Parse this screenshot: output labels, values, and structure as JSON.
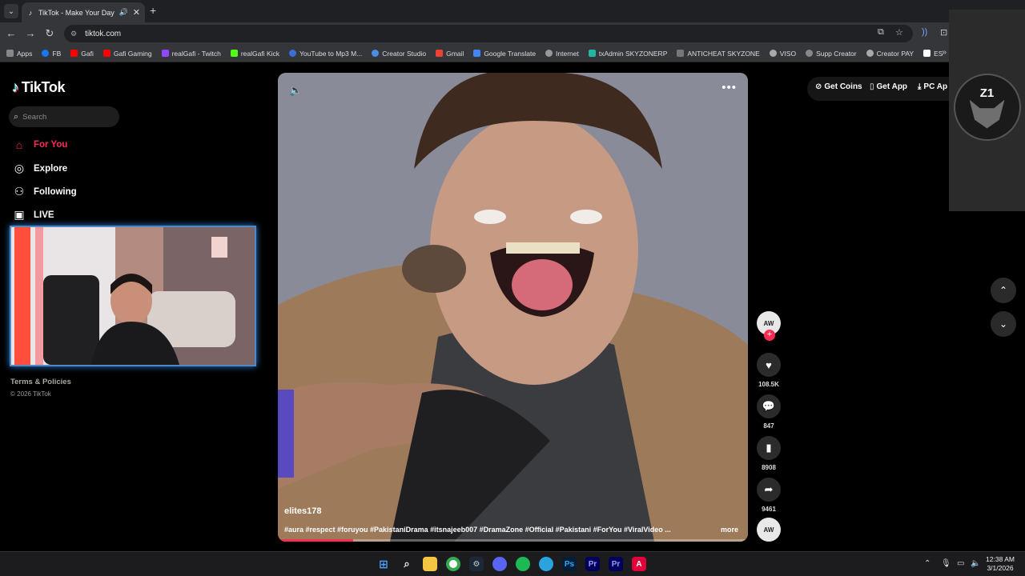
{
  "browser": {
    "tab_title": "TikTok - Make Your Day",
    "url": "tiktok.com",
    "bookmarks": [
      "Apps",
      "FB",
      "Gafi",
      "Gafi Gaming",
      "realGafi - Twitch",
      "realGafi Kick",
      "YouTube to Mp3 M...",
      "Creator Studio",
      "Gmail",
      "Google Translate",
      "Internet",
      "txAdmin SKYZONERP",
      "ANTICHEAT SKYZONE",
      "VISO",
      "Supp Creator",
      "Creator PAY",
      "ES"
    ]
  },
  "sidebar": {
    "logo": "TikTok",
    "search_placeholder": "Search",
    "nav": [
      "For You",
      "Explore",
      "Following",
      "LIVE"
    ],
    "footer_link": "Terms & Policies",
    "copyright": "© 2026 TikTok"
  },
  "header_actions": {
    "get_coins": "Get Coins",
    "get_app": "Get App",
    "pc_app": "PC Ap"
  },
  "overlay": {
    "mark": "Z1"
  },
  "video": {
    "author": "elites178",
    "caption": "#aura #respect #foruyou #PakistaniDrama #itsnajeeb007 #DramaZone #Official #Pakistani #ForYou #ViralVideo ...",
    "more": "more",
    "progress": 0.16
  },
  "actions": {
    "creator_avatar": "AW",
    "likes": "108.5K",
    "comments": "847",
    "saves": "8908",
    "shares": "9461"
  },
  "taskbar": {
    "time": "12:38 AM",
    "date": "3/1/2026"
  },
  "colors": {
    "accent": "#fe2c55",
    "chrome": "#35363a"
  }
}
